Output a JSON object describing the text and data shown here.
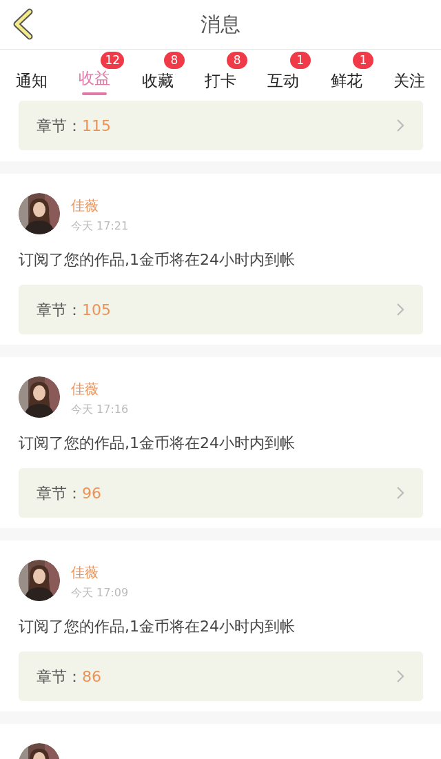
{
  "header": {
    "title": "消息"
  },
  "tabs": [
    {
      "label": "通知",
      "selected": false
    },
    {
      "label": "收益",
      "badge": "12",
      "selected": true
    },
    {
      "label": "收藏",
      "badge": "8",
      "selected": false
    },
    {
      "label": "打卡",
      "badge": "8",
      "selected": false
    },
    {
      "label": "互动",
      "badge": "1",
      "selected": false
    },
    {
      "label": "鲜花",
      "badge": "1",
      "selected": false
    },
    {
      "label": "关注",
      "selected": false
    }
  ],
  "partial_item": {
    "chapter_label": "章节：",
    "chapter": "115"
  },
  "items": [
    {
      "kind": "message",
      "name": "佳薇",
      "time": "今天 17:21",
      "message": "订阅了您的作品,1金币将在24小时内到帐",
      "chapter_label": "章节：",
      "chapter": "105"
    },
    {
      "kind": "message",
      "name": "佳薇",
      "time": "今天 17:16",
      "message": "订阅了您的作品,1金币将在24小时内到帐",
      "chapter_label": "章节：",
      "chapter": "96"
    },
    {
      "kind": "message",
      "name": "佳薇",
      "time": "今天 17:09",
      "message": "订阅了您的作品,1金币将在24小时内到帐",
      "chapter_label": "章节：",
      "chapter": "86"
    },
    {
      "kind": "cut"
    }
  ]
}
